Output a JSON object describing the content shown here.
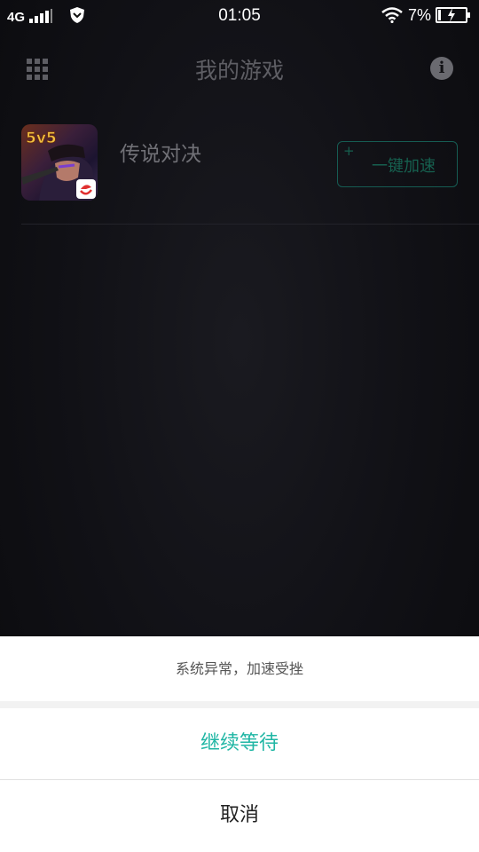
{
  "status_bar": {
    "network": "4G",
    "time": "01:05",
    "battery": "7%"
  },
  "header": {
    "title": "我的游戏",
    "menu_icon": "grid-icon",
    "info_icon": "info-icon"
  },
  "games": [
    {
      "name": "传说对决",
      "icon_badge": "5v5",
      "boost_plus": "+",
      "boost_label": "一键加速"
    }
  ],
  "dialog": {
    "message": "系统异常，加速受挫",
    "confirm_label": "继续等待",
    "cancel_label": "取消"
  },
  "colors": {
    "accent": "#1fb6a4",
    "background": "#111116",
    "dialog_bg": "#ffffff"
  }
}
